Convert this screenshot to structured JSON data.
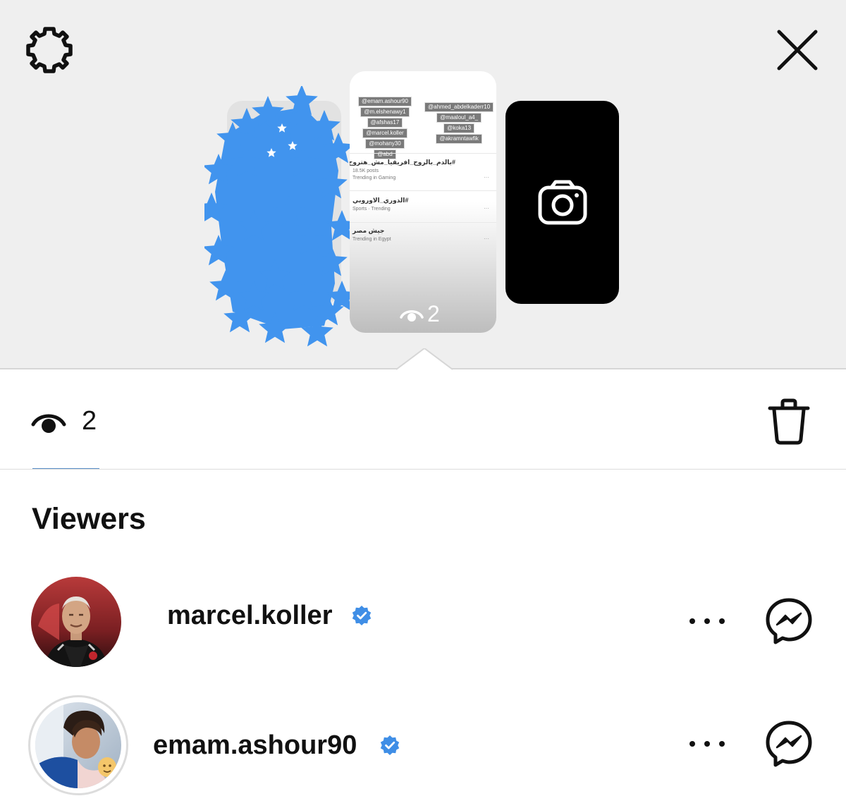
{
  "header": {
    "settings_icon": "gear-icon",
    "close_icon": "close-icon"
  },
  "story_preview": {
    "tags_left": [
      "@emam.ashour90",
      "@m.elshenawy1",
      "@afshas17",
      "@marcel.koller",
      "@mohany30",
      "@abd"
    ],
    "tags_right": [
      "@ahmed_abdelkaderr10",
      "@maaloul_a4_",
      "@koka13",
      "@akramntawfik"
    ],
    "trends": [
      {
        "title": "#بالدم_بالروح_افريقيا_مش_هتروح",
        "sub": "18.5K posts",
        "meta": "Trending in Gaming",
        "dots": "···"
      },
      {
        "title": "#الدوري_الاوروبي",
        "sub": "",
        "meta": "Sports · Trending",
        "dots": "···"
      },
      {
        "title": "جيش مصر",
        "sub": "",
        "meta": "Trending in Egypt",
        "dots": "···"
      }
    ],
    "card_view_count": "2",
    "camera_icon": "camera-icon"
  },
  "stats": {
    "views_icon": "eye-icon",
    "view_count": "2",
    "delete_icon": "trash-icon"
  },
  "viewers": {
    "heading": "Viewers",
    "items": [
      {
        "username": "marcel.koller",
        "verified": true
      },
      {
        "username": "emam.ashour90",
        "verified": true
      }
    ]
  },
  "colors": {
    "verified_blue": "#3f8ee6",
    "blob_blue": "#4194ee",
    "top_background": "#efefef"
  }
}
